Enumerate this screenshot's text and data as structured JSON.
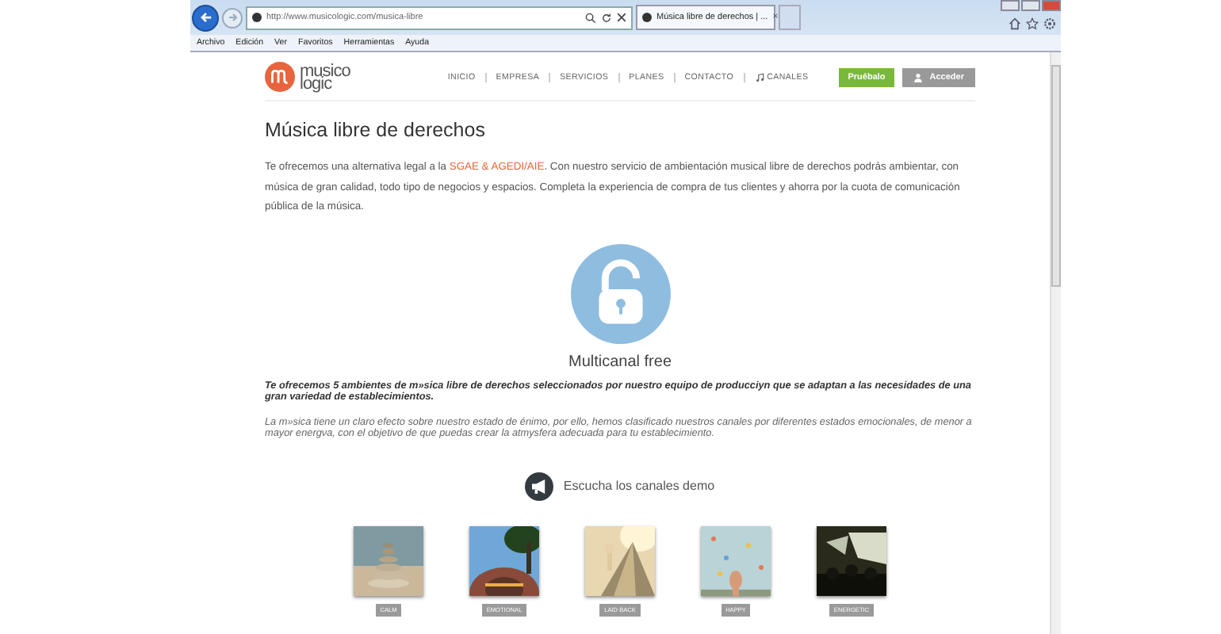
{
  "browser": {
    "address": "http://www.musicologic.com/musica-libre",
    "tab_title": "Música libre de derechos | ...",
    "tab_close": "×",
    "menu": [
      "Archivo",
      "Edición",
      "Ver",
      "Favoritos",
      "Herramientas",
      "Ayuda"
    ]
  },
  "site": {
    "logo_top": "musico",
    "logo_bottom": "logic",
    "nav": [
      {
        "label": "INICIO",
        "kind": "text"
      },
      {
        "label": "EMPRESA",
        "kind": "text"
      },
      {
        "label": "SERVICIOS",
        "kind": "text"
      },
      {
        "label": "PLANES",
        "kind": "text"
      },
      {
        "label": "CONTACTO",
        "kind": "text"
      },
      {
        "label": "CANALES",
        "kind": "note"
      }
    ],
    "try_button": "Pruébalo",
    "login_button": "Acceder"
  },
  "heading": "Música libre de derechos",
  "intro": [
    {
      "text": "Te ofrecemos una alternativa legal a la ",
      "kind": "plain"
    },
    {
      "text": "SGAE & AGEDI/AIE",
      "kind": "link"
    },
    {
      "text": ". Con nuestro servicio de ambientación musical libre de derechos podrás ambientar, con música de gran calidad, todo tipo de negocios y espacios. Completa la experiencia de compra de tus clientes y ahorra por la cuota de comunicación pública de la música.",
      "kind": "plain"
    }
  ],
  "feature_title": "Multicanal free",
  "lead": "Te ofrecemos 5 ambientes de m»sica libre de derechos seleccionados por nuestro equipo de producciyn que se adaptan a las necesidades de una gran variedad de establecimientos.",
  "body": "La m»sica tiene un claro efecto sobre nuestro estado de énimo, por ello, hemos clasificado nuestros canales por diferentes estados emocionales, de menor a mayor energνa, con el objetivo de que puedas crear la atmysfera adecuada para tu establecimiento.",
  "demo_title": "Escucha los canales demo",
  "channels": [
    {
      "label": "CALM"
    },
    {
      "label": "EMOTIONAL"
    },
    {
      "label": "LAID BACK"
    },
    {
      "label": "HAPPY"
    },
    {
      "label": "ENERGETIC"
    }
  ]
}
